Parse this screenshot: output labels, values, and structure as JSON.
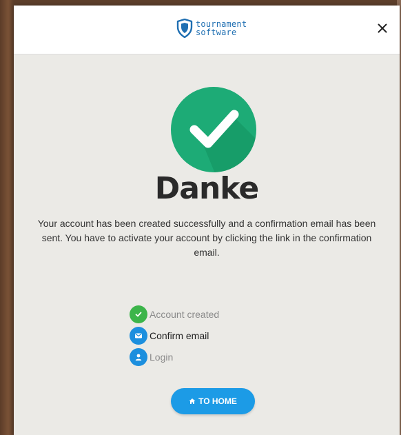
{
  "header": {
    "logo_line1": "tournament",
    "logo_line2": "software",
    "close_icon": "close-icon"
  },
  "main": {
    "badge_icon": "checkmark-icon",
    "title": "Danke",
    "message": "Your account has been created successfully and a confirmation email has been sent. You have to activate your account by clicking the link in the confirmation email."
  },
  "steps": [
    {
      "label": "Account created",
      "icon": "check-icon",
      "state": "done"
    },
    {
      "label": "Confirm email",
      "icon": "envelope-icon",
      "state": "current"
    },
    {
      "label": "Login",
      "icon": "user-icon",
      "state": "pending"
    }
  ],
  "footer": {
    "home_label": "TO HOME",
    "home_icon": "home-icon"
  },
  "colors": {
    "brand_blue": "#1f6fb2",
    "success_green": "#1dab76",
    "step_green": "#3cb54a",
    "button_blue": "#1c9be6",
    "panel_bg": "#ebeae6"
  }
}
